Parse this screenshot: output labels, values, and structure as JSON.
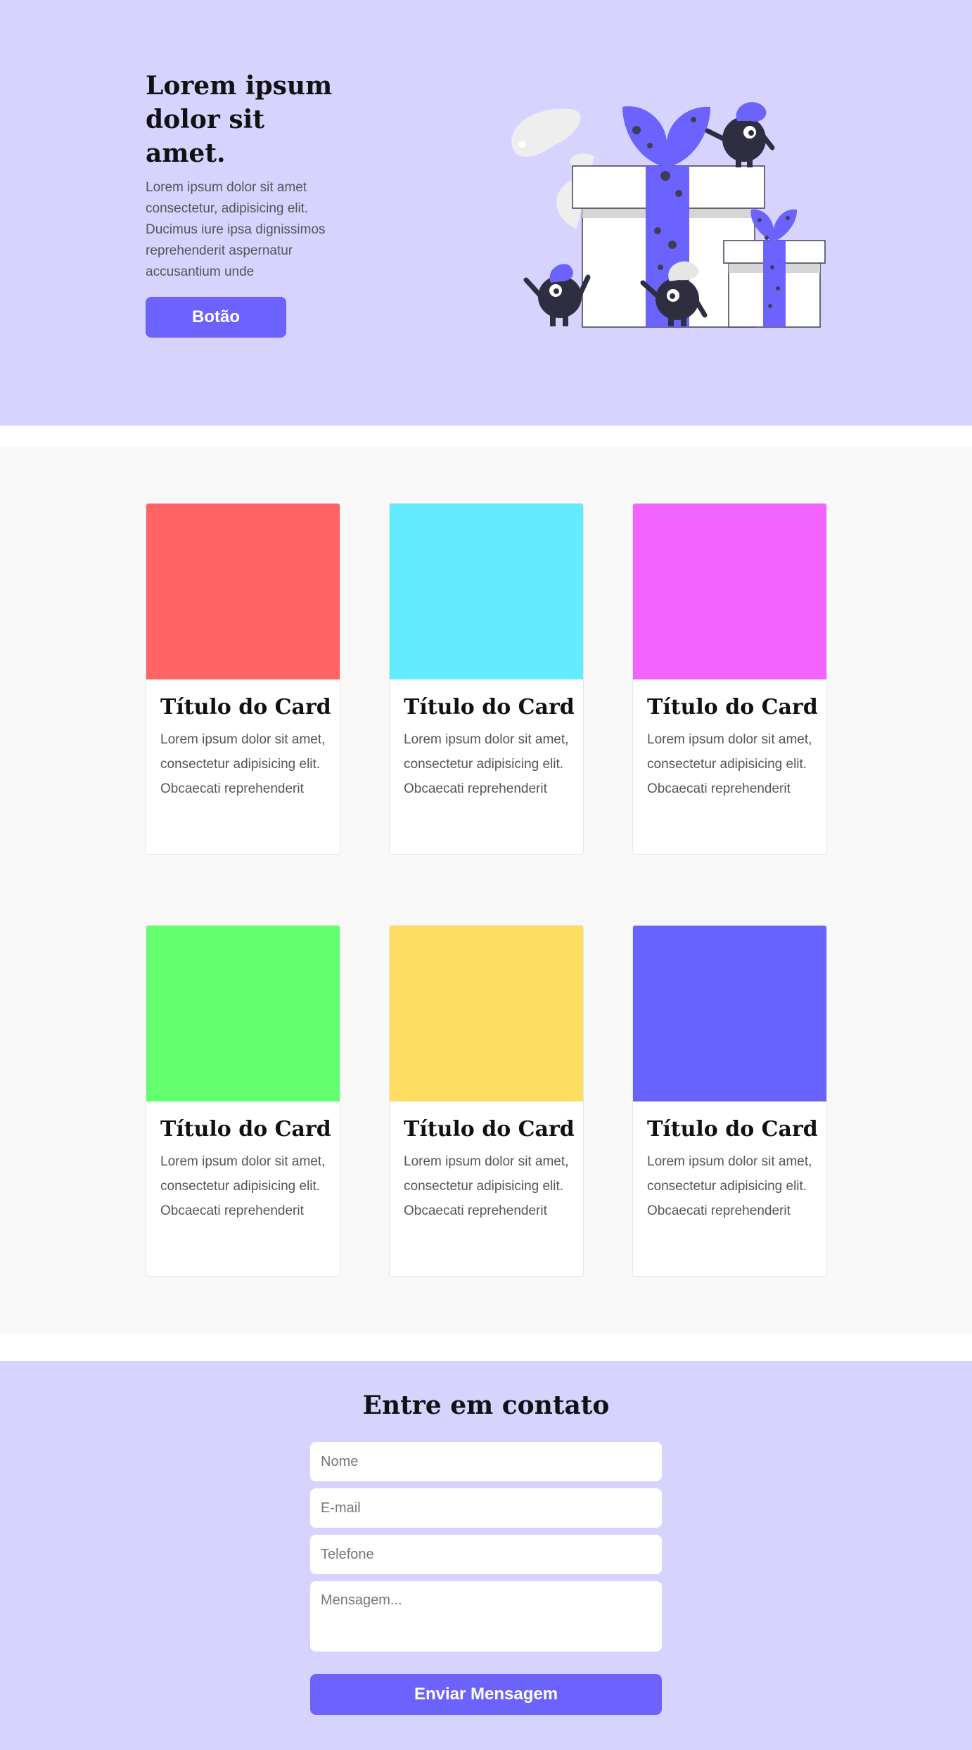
{
  "hero": {
    "title": "Lorem ipsum dolor sit amet.",
    "description": "Lorem ipsum dolor sit amet consectetur, adipisicing elit. Ducimus iure ipsa dignissimos reprehenderit aspernatur accusantium unde",
    "button_label": "Botão"
  },
  "cards": [
    {
      "title": "Título do Card",
      "text": "Lorem ipsum dolor sit amet, consectetur adipisicing elit. Obcaecati reprehenderit",
      "color": "#ff6363"
    },
    {
      "title": "Título do Card",
      "text": "Lorem ipsum dolor sit amet, consectetur adipisicing elit. Obcaecati reprehenderit",
      "color": "#63ecff"
    },
    {
      "title": "Título do Card",
      "text": "Lorem ipsum dolor sit amet, consectetur adipisicing elit. Obcaecati reprehenderit",
      "color": "#f363ff"
    },
    {
      "title": "Título do Card",
      "text": "Lorem ipsum dolor sit amet, consectetur adipisicing elit. Obcaecati reprehenderit",
      "color": "#63ff6f"
    },
    {
      "title": "Título do Card",
      "text": "Lorem ipsum dolor sit amet, consectetur adipisicing elit. Obcaecati reprehenderit",
      "color": "#ffdd63"
    },
    {
      "title": "Título do Card",
      "text": "Lorem ipsum dolor sit amet, consectetur adipisicing elit. Obcaecati reprehenderit",
      "color": "#6663ff"
    }
  ],
  "contact": {
    "title": "Entre em contato",
    "name_placeholder": "Nome",
    "email_placeholder": "E-mail",
    "phone_placeholder": "Telefone",
    "message_placeholder": "Mensagem...",
    "submit_label": "Enviar Mensagem"
  },
  "colors": {
    "accent": "#6c63ff",
    "hero_bg": "#d7d3ff",
    "cards_bg": "#f8f8f8"
  }
}
